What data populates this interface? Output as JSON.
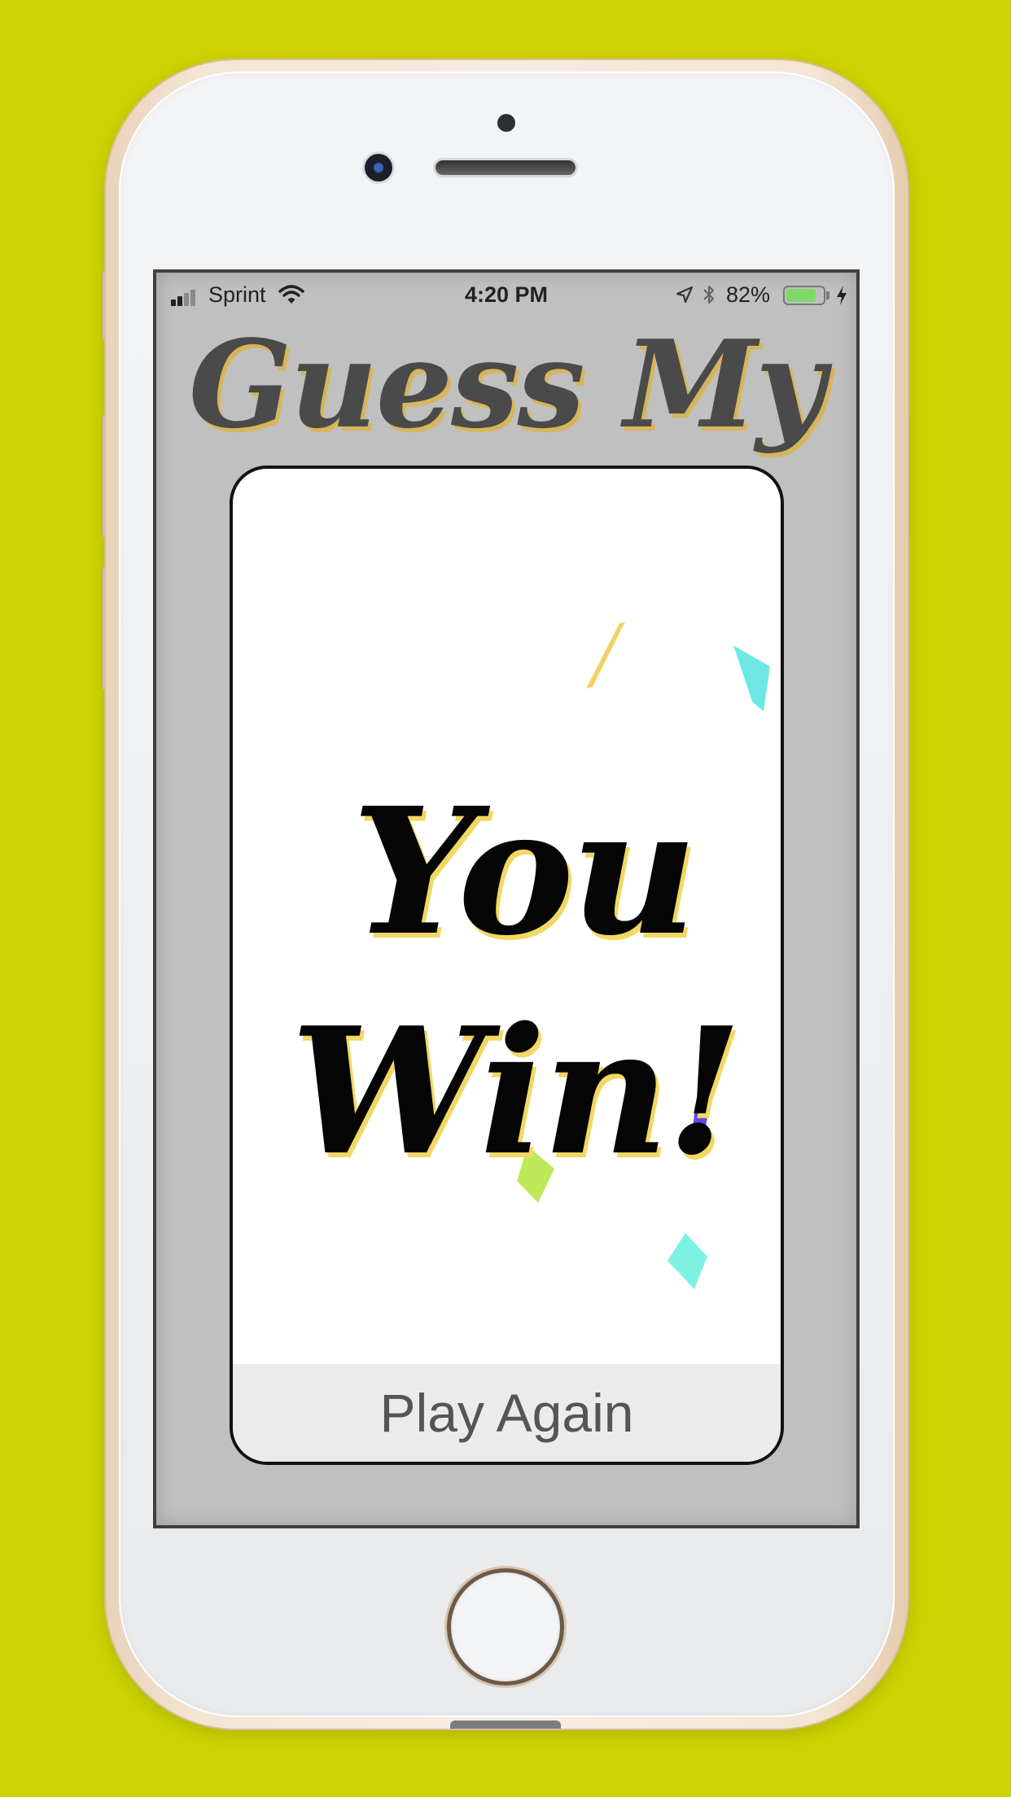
{
  "colors": {
    "background": "#cdd200",
    "screen_background": "#c0c0c0",
    "title_color": "#4a4a4a",
    "title_shadow": "#d7b55a",
    "win_text_color": "#050505",
    "win_text_shadow": "#f2d763",
    "button_background": "#ebebeb"
  },
  "status_bar": {
    "carrier": "Sprint",
    "time": "4:20 PM",
    "battery_percent": "82%",
    "battery_level": 0.82,
    "icons": [
      "signal-icon",
      "wifi-icon",
      "location-arrow-icon",
      "bluetooth-icon",
      "battery-icon",
      "charging-bolt-icon"
    ]
  },
  "app": {
    "title": "Guess My"
  },
  "win_card": {
    "line1": "You",
    "line2": "Win!",
    "confetti_colors": [
      "#f2d263",
      "#6ee8e4",
      "#5a4ee6",
      "#bde95a",
      "#7ef2e2"
    ]
  },
  "actions": {
    "play_again_label": "Play Again"
  }
}
